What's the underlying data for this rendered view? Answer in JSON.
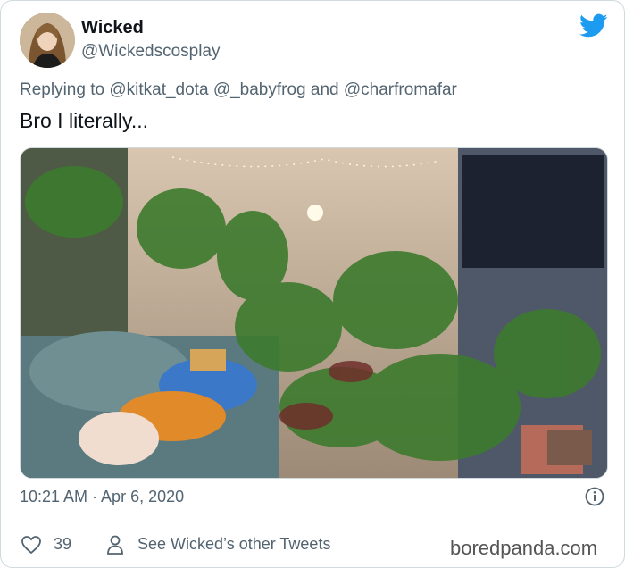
{
  "tweet": {
    "display_name": "Wicked",
    "handle": "@Wickedscosplay",
    "replying_prefix": "Replying to",
    "mention_1": "@kitkat_dota",
    "mention_2": "@_babyfrog",
    "conjunction": "and",
    "mention_3": "@charfromafar",
    "text": "Bro I literally...",
    "timestamp": "10:21 AM · Apr 6, 2020",
    "like_count": "39",
    "see_others_label": "See Wicked’s other Tweets"
  },
  "icons": {
    "platform": "twitter-bird-icon",
    "info": "info-icon",
    "like": "heart-icon",
    "profile": "person-icon"
  },
  "colors": {
    "twitter_blue": "#1d9bf0",
    "secondary_text": "#536471",
    "primary_text": "#0f1419"
  },
  "watermark": "boredpanda.com"
}
